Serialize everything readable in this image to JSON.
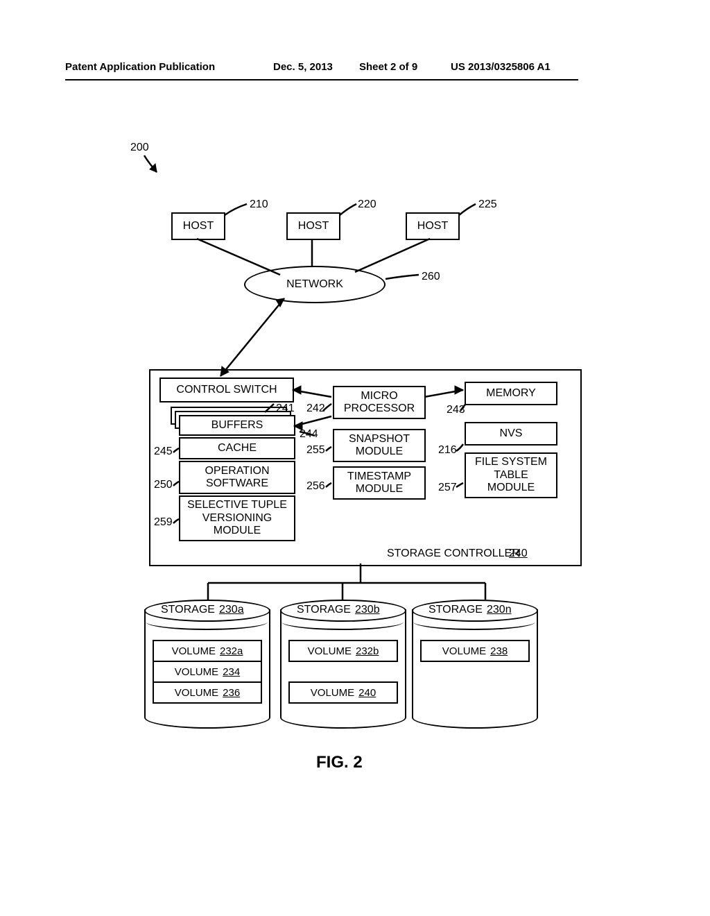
{
  "header": {
    "publication": "Patent Application Publication",
    "date": "Dec. 5, 2013",
    "sheet": "Sheet 2 of 9",
    "pubnum": "US 2013/0325806 A1"
  },
  "fig_label": "200",
  "hosts": {
    "label": "HOST",
    "refs": {
      "a": "210",
      "b": "220",
      "c": "225"
    }
  },
  "network": {
    "label": "NETWORK",
    "ref": "260"
  },
  "controller": {
    "label": "STORAGE CONTROLLER",
    "num": "240",
    "items": {
      "control_switch": "CONTROL SWITCH",
      "buffers": "BUFFERS",
      "cache": "CACHE",
      "op_sw": "OPERATION\nSOFTWARE",
      "sel_tuple": "SELECTIVE TUPLE\nVERSIONING\nMODULE",
      "microproc": "MICRO\nPROCESSOR",
      "snapshot": "SNAPSHOT\nMODULE",
      "timestamp": "TIMESTAMP\nMODULE",
      "memory": "MEMORY",
      "nvs": "NVS",
      "fs_table": "FILE SYSTEM\nTABLE\nMODULE"
    },
    "refs": {
      "control_switch": "241",
      "microproc": "242",
      "memory": "243",
      "buffers": "244",
      "cache": "245",
      "op_sw": "250",
      "snapshot": "255",
      "timestamp": "256",
      "fs_table": "257",
      "sel_tuple": "259",
      "nvs": "216"
    }
  },
  "storage": {
    "a": {
      "label": "STORAGE",
      "num": "230a",
      "volumes": [
        {
          "l": "VOLUME",
          "n": "232a"
        },
        {
          "l": "VOLUME",
          "n": "234"
        },
        {
          "l": "VOLUME",
          "n": "236"
        }
      ]
    },
    "b": {
      "label": "STORAGE",
      "num": "230b",
      "volumes": [
        {
          "l": "VOLUME",
          "n": "232b"
        },
        {
          "l": "VOLUME",
          "n": "240"
        }
      ]
    },
    "n": {
      "label": "STORAGE",
      "num": "230n",
      "volumes": [
        {
          "l": "VOLUME",
          "n": "238"
        }
      ]
    }
  },
  "caption": "FIG. 2"
}
